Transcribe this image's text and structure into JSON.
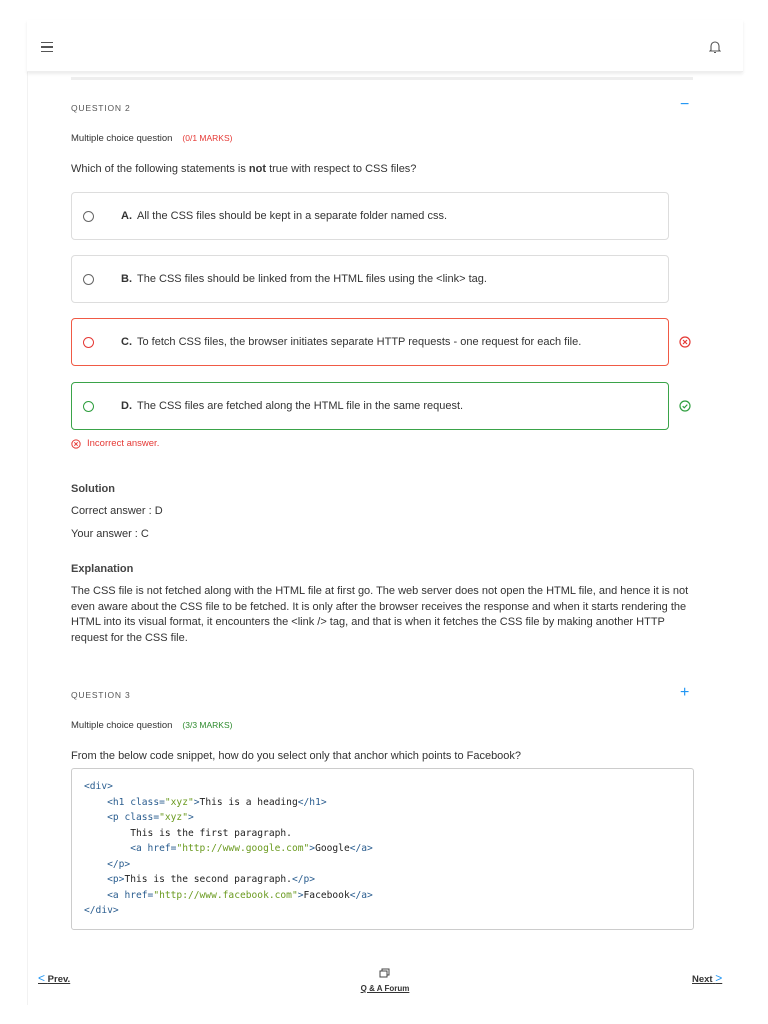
{
  "header": {
    "menu_icon": "hamburger-icon",
    "bell_icon": "bell-icon"
  },
  "question2": {
    "label": "QUESTION 2",
    "toggle": "−",
    "type": "Multiple choice question",
    "marks": "(0/1 MARKS)",
    "text_before": "Which of the following statements is ",
    "text_bold": "not",
    "text_after": " true with respect to CSS files?",
    "options": [
      {
        "letter": "A.",
        "text": "All the CSS files should be kept in a separate folder named css."
      },
      {
        "letter": "B.",
        "text": "The CSS files should be linked from the HTML files using the <link> tag."
      },
      {
        "letter": "C.",
        "text": "To fetch CSS files, the browser initiates separate HTTP requests - one request for each file."
      },
      {
        "letter": "D.",
        "text": "The CSS files are fetched along the HTML file in the same request."
      }
    ],
    "feedback": "Incorrect answer.",
    "solution_heading": "Solution",
    "correct_answer": "Correct answer : D",
    "your_answer": "Your answer : C",
    "explanation_heading": "Explanation",
    "explanation": "The CSS file is not fetched along with the HTML file at first go. The web server does not open the HTML file, and hence it is not even aware about the CSS file to be fetched. It is only after the browser receives the response and when it starts rendering the HTML into its visual format, it encounters the <link /> tag, and that is when it fetches the CSS file by making another HTTP request for the CSS file."
  },
  "question3": {
    "label": "QUESTION 3",
    "toggle": "+",
    "type": "Multiple choice question",
    "marks": "(3/3 MARKS)",
    "text": "From the below code snippet, how do you select only that anchor which points to Facebook?",
    "code": [
      [
        [
          "tag",
          "<div>"
        ]
      ],
      [
        [
          "text",
          "    "
        ],
        [
          "tag",
          "<h1 "
        ],
        [
          "attr",
          "class="
        ],
        [
          "str",
          "\"xyz\""
        ],
        [
          "tag",
          ">"
        ],
        [
          "text",
          "This is a heading"
        ],
        [
          "tag",
          "</h1>"
        ]
      ],
      [
        [
          "text",
          "    "
        ],
        [
          "tag",
          "<p "
        ],
        [
          "attr",
          "class="
        ],
        [
          "str",
          "\"xyz\""
        ],
        [
          "tag",
          ">"
        ]
      ],
      [
        [
          "text",
          "        This is the first paragraph."
        ]
      ],
      [
        [
          "text",
          "        "
        ],
        [
          "tag",
          "<a "
        ],
        [
          "attr",
          "href="
        ],
        [
          "str",
          "\"http://www.google.com\""
        ],
        [
          "tag",
          ">"
        ],
        [
          "text",
          "Google"
        ],
        [
          "tag",
          "</a>"
        ]
      ],
      [
        [
          "text",
          "    "
        ],
        [
          "tag",
          "</p>"
        ]
      ],
      [
        [
          "text",
          "    "
        ],
        [
          "tag",
          "<p>"
        ],
        [
          "text",
          "This is the second paragraph."
        ],
        [
          "tag",
          "</p>"
        ]
      ],
      [
        [
          "text",
          "    "
        ],
        [
          "tag",
          "<a "
        ],
        [
          "attr",
          "href="
        ],
        [
          "str",
          "\"http://www.facebook.com\""
        ],
        [
          "tag",
          ">"
        ],
        [
          "text",
          "Facebook"
        ],
        [
          "tag",
          "</a>"
        ]
      ],
      [
        [
          "tag",
          "</div>"
        ]
      ]
    ]
  },
  "footer": {
    "prev": "Prev.",
    "forum": "Q & A Forum",
    "next": "Next"
  },
  "colors": {
    "accent": "#2196f3",
    "error": "#e53935",
    "success": "#2e9e3e"
  }
}
